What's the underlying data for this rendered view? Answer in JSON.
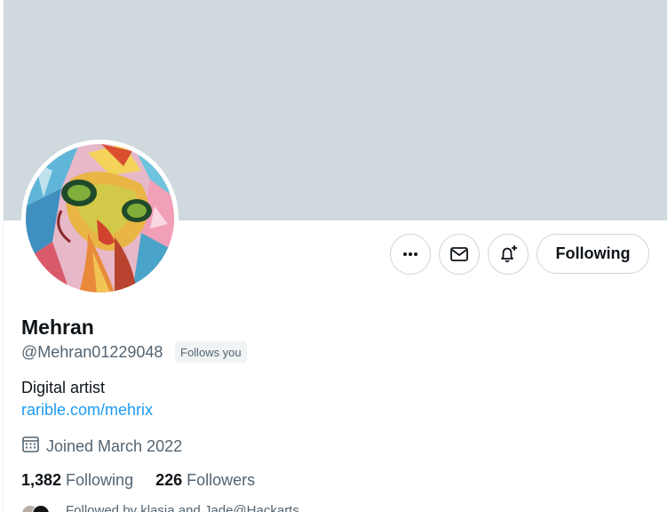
{
  "profile": {
    "display_name": "Mehran",
    "handle": "@Mehran01229048",
    "follows_you_badge": "Follows you",
    "bio": "Digital artist",
    "website": "rarible.com/mehrix",
    "joined": "Joined March 2022"
  },
  "actions": {
    "more_icon": "more-horizontal-icon",
    "message_icon": "envelope-icon",
    "notify_icon": "bell-plus-icon",
    "following_label": "Following"
  },
  "stats": {
    "following_count": "1,382",
    "following_label": "Following",
    "followers_count": "226",
    "followers_label": "Followers"
  },
  "followed_by": {
    "text": "Followed by klasia and Jade@Hackarts"
  },
  "colors": {
    "banner": "#cfd9de",
    "accent_link": "#1d9bf0",
    "secondary_text": "#536471"
  }
}
